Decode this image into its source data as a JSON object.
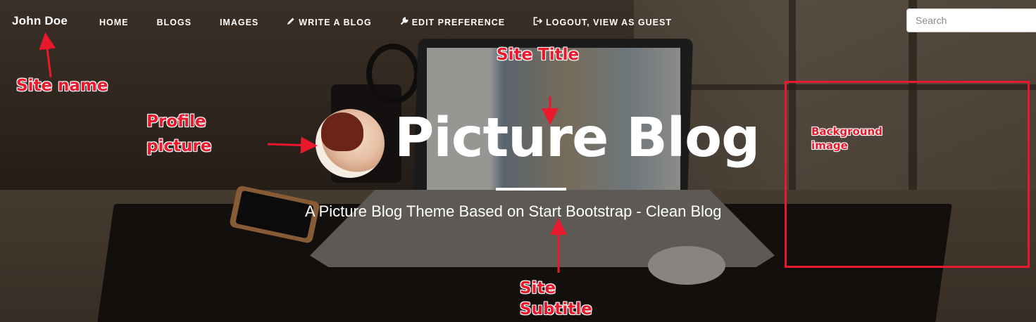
{
  "navbar": {
    "brand": "John Doe",
    "items": [
      {
        "label": "HOME",
        "icon": ""
      },
      {
        "label": "BLOGS",
        "icon": ""
      },
      {
        "label": "IMAGES",
        "icon": ""
      },
      {
        "label": "WRITE A BLOG",
        "icon": "pencil-icon"
      },
      {
        "label": "EDIT PREFERENCE",
        "icon": "wrench-icon"
      },
      {
        "label": "LOGOUT, VIEW AS GUEST",
        "icon": "logout-icon"
      }
    ],
    "search": {
      "placeholder": "Search"
    }
  },
  "header": {
    "title": "Picture Blog",
    "subtitle": "A Picture Blog Theme Based on Start Bootstrap - Clean Blog"
  },
  "annotations": {
    "site_name": "Site name",
    "site_title": "Site Title",
    "profile_picture_line1": "Profile",
    "profile_picture_line2": "picture",
    "background_image_line1": "Background",
    "background_image_line2": "image",
    "site_subtitle_line1": "Site",
    "site_subtitle_line2": "Subtitle"
  },
  "colors": {
    "annotation": "#e8192c",
    "text": "#ffffff"
  }
}
